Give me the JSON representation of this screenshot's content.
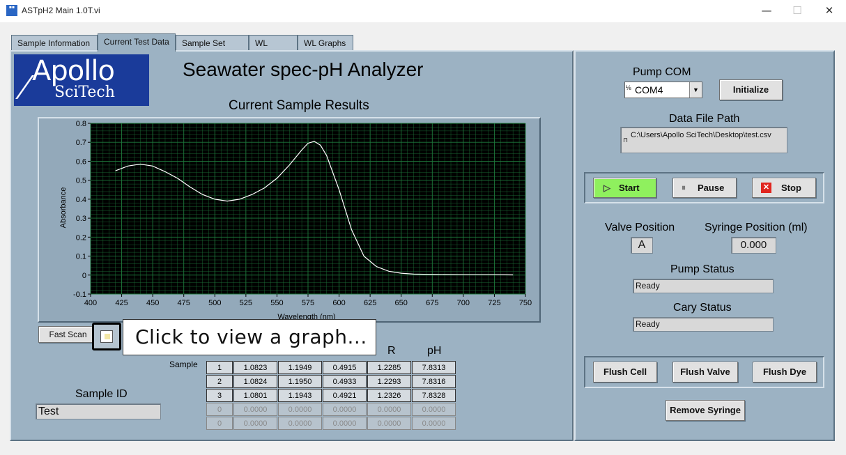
{
  "window": {
    "title": "ASTpH2 Main 1.0T.vi",
    "minimize": "—",
    "maximize": "☐",
    "close": "✕"
  },
  "tabs": [
    {
      "label": "Sample Information"
    },
    {
      "label": "Current Test Data"
    },
    {
      "label": "Sample Set Data"
    },
    {
      "label": "WL Setup"
    },
    {
      "label": "WL Graphs"
    }
  ],
  "active_tab": "Current Test Data",
  "logo": {
    "line1": "Apollo",
    "line2": "SciTech"
  },
  "header": {
    "title": "Seawater spec-pH Analyzer"
  },
  "chart_title": "Current Sample Results",
  "chart_data": {
    "type": "line",
    "title": "Current Sample Results",
    "xlabel": "Wavelength (nm)",
    "ylabel": "Absorbance",
    "xlim": [
      400,
      750
    ],
    "ylim": [
      -0.1,
      0.8
    ],
    "xticks": [
      400,
      425,
      450,
      475,
      500,
      525,
      550,
      575,
      600,
      625,
      650,
      675,
      700,
      725,
      750
    ],
    "yticks": [
      -0.1,
      0,
      0.1,
      0.2,
      0.3,
      0.4,
      0.5,
      0.6,
      0.7,
      0.8
    ],
    "grid": true,
    "background": "#000000",
    "grid_color": "#1e7a3c",
    "line_color": "#ffffff",
    "series": [
      {
        "x": [
          420,
          430,
          440,
          450,
          460,
          470,
          480,
          490,
          500,
          510,
          520,
          530,
          540,
          550,
          560,
          570,
          575,
          580,
          585,
          590,
          600,
          610,
          620,
          630,
          640,
          650,
          660,
          680,
          700,
          720,
          740
        ],
        "y": [
          0.55,
          0.575,
          0.585,
          0.575,
          0.545,
          0.51,
          0.465,
          0.425,
          0.4,
          0.39,
          0.4,
          0.425,
          0.46,
          0.51,
          0.58,
          0.66,
          0.695,
          0.705,
          0.685,
          0.63,
          0.45,
          0.24,
          0.1,
          0.045,
          0.02,
          0.01,
          0.005,
          0.003,
          0.002,
          0.002,
          0.001
        ]
      }
    ]
  },
  "controls": {
    "fast_scan": "Fast Scan",
    "tooltip": "Click to view a graph..."
  },
  "sample_id": {
    "label": "Sample ID",
    "value": "Test"
  },
  "results": {
    "row_label": "Sample",
    "headers": [
      "R",
      "pH"
    ],
    "rows": [
      [
        "1",
        "1.0823",
        "1.1949",
        "0.4915",
        "1.2285",
        "7.8313"
      ],
      [
        "2",
        "1.0824",
        "1.1950",
        "0.4933",
        "1.2293",
        "7.8316"
      ],
      [
        "3",
        "1.0801",
        "1.1943",
        "0.4921",
        "1.2326",
        "7.8328"
      ],
      [
        "0",
        "0.0000",
        "0.0000",
        "0.0000",
        "0.0000",
        "0.0000"
      ],
      [
        "0",
        "0.0000",
        "0.0000",
        "0.0000",
        "0.0000",
        "0.0000"
      ]
    ]
  },
  "right_panel": {
    "pump_com_label": "Pump COM",
    "pump_com_value": "COM4",
    "initialize": "Initialize",
    "data_file_label": "Data File Path",
    "data_file_value": "C:\\Users\\Apollo SciTech\\Desktop\\test.csv",
    "start": "Start",
    "pause": "Pause",
    "stop": "Stop",
    "valve_label": "Valve Position",
    "valve_value": "A",
    "syringe_label": "Syringe Position (ml)",
    "syringe_value": "0.000",
    "pump_status_label": "Pump Status",
    "pump_status_value": "Ready",
    "cary_status_label": "Cary Status",
    "cary_status_value": "Ready",
    "flush_cell": "Flush Cell",
    "flush_valve": "Flush Valve",
    "flush_dye": "Flush Dye",
    "remove_syringe": "Remove Syringe"
  }
}
